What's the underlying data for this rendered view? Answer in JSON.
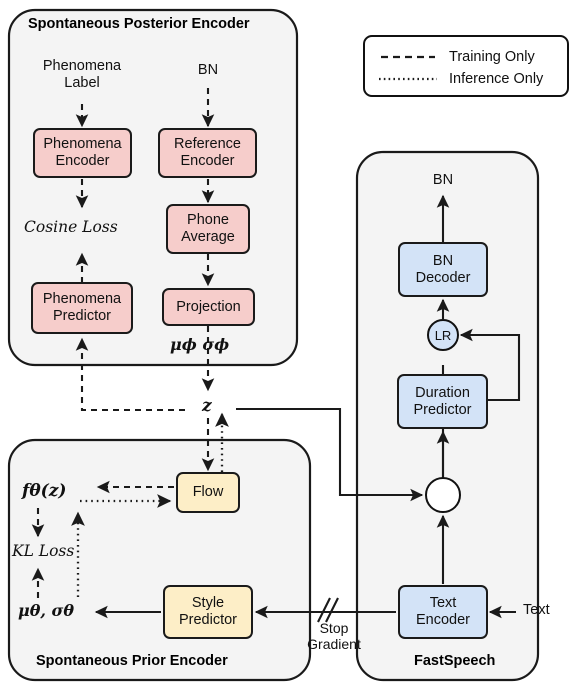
{
  "figure": {
    "type": "architecture-diagram",
    "panels": [
      {
        "id": "posterior",
        "title": "Spontaneous Posterior Encoder",
        "title_position": "top"
      },
      {
        "id": "prior",
        "title": "Spontaneous Prior Encoder",
        "title_position": "bottom"
      },
      {
        "id": "fastspeech",
        "title": "FastSpeech",
        "title_position": "bottom"
      }
    ]
  },
  "legend": {
    "items": [
      {
        "style": "dashed",
        "label": "Training Only"
      },
      {
        "style": "dotted",
        "label": "Inference Only"
      }
    ]
  },
  "posterior": {
    "title": "Spontaneous Posterior Encoder",
    "inputs": [
      {
        "name": "phenomena-label",
        "text": "Phenomena\nLabel",
        "line1": "Phenomena",
        "line2": "Label"
      },
      {
        "name": "bn-input",
        "text": "BN"
      }
    ],
    "nodes": [
      {
        "id": "phenomena-encoder",
        "label": "Phenomena\nEncoder",
        "line1": "Phenomena",
        "line2": "Encoder",
        "color": "#f6cdcb"
      },
      {
        "id": "reference-encoder",
        "label": "Reference\nEncoder",
        "line1": "Reference",
        "line2": "Encoder",
        "color": "#f6cdcb"
      },
      {
        "id": "phone-average",
        "label": "Phone\nAverage",
        "line1": "Phone",
        "line2": "Average",
        "color": "#f6cdcb"
      },
      {
        "id": "projection",
        "label": "Projection",
        "line1": "Projection",
        "line2": "",
        "color": "#f6cdcb"
      },
      {
        "id": "phenomena-predictor",
        "label": "Phenomena\nPredictor",
        "line1": "Phenomena",
        "line2": "Predictor",
        "color": "#f6cdcb"
      }
    ],
    "loss_label": "Cosine Loss",
    "dist_params": "μϕ  σϕ"
  },
  "latent": {
    "symbol": "z"
  },
  "prior": {
    "title": "Spontaneous Prior Encoder",
    "nodes": [
      {
        "id": "flow",
        "label": "Flow",
        "line1": "Flow",
        "line2": "",
        "color": "#fdeec7"
      },
      {
        "id": "style-predictor",
        "label": "Style\nPredictor",
        "line1": "Style",
        "line2": "Predictor",
        "color": "#fdeec7"
      }
    ],
    "flow_output": "fθ(z)",
    "loss_label": "KL Loss",
    "dist_params": "μθ,  σθ"
  },
  "fastspeech": {
    "title": "FastSpeech",
    "output": "BN",
    "input": "Text",
    "nodes": [
      {
        "id": "bn-decoder",
        "label": "BN\nDecoder",
        "line1": "BN",
        "line2": "Decoder",
        "color": "#d3e3f7"
      },
      {
        "id": "duration-predictor",
        "label": "Duration\nPredictor",
        "line1": "Duration",
        "line2": "Predictor",
        "color": "#d3e3f7"
      },
      {
        "id": "text-encoder",
        "label": "Text\nEncoder",
        "line1": "Text",
        "line2": "Encoder",
        "color": "#d3e3f7"
      }
    ],
    "operators": [
      {
        "id": "length-regulator",
        "label": "LR",
        "shape": "circle",
        "color": "#d3e3f7"
      },
      {
        "id": "add-operator",
        "label": "",
        "shape": "circle-plus",
        "color": "#ffffff"
      }
    ]
  },
  "stop_gradient": {
    "line1": "Stop",
    "line2": "Gradient",
    "marker": "//"
  },
  "colors": {
    "pink": "#f6cdcb",
    "blue": "#d3e3f7",
    "cream": "#fdeec7",
    "panel_fill": "#f4f4f4",
    "stroke": "#1a1a1a"
  }
}
